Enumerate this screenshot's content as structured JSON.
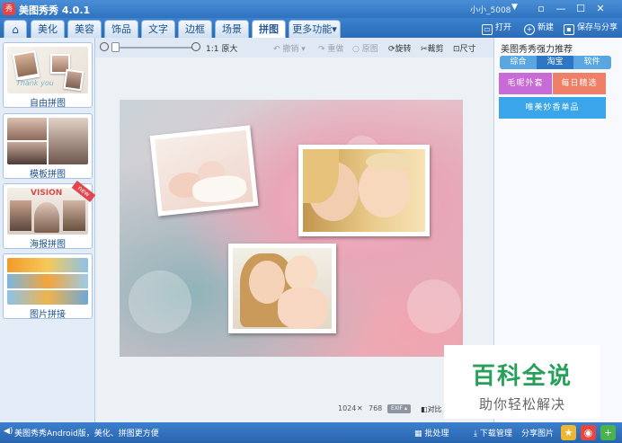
{
  "window": {
    "app_title": "美图秀秀 4.0.1",
    "logo_text": "秀",
    "user": "小小_5008",
    "controls": [
      "▫",
      "—",
      "☐",
      "✕"
    ]
  },
  "tabs": {
    "home_icon": "home-icon",
    "items": [
      "美化",
      "美容",
      "饰品",
      "文字",
      "边框",
      "场景",
      "拼图",
      "更多功能"
    ],
    "active": "拼图",
    "open_label": "打开",
    "new_label": "新建",
    "save_label": "保存与分享"
  },
  "left_panel": {
    "items": [
      {
        "label": "自由拼图",
        "thumb_text": "Thank you"
      },
      {
        "label": "模板拼图"
      },
      {
        "label": "海报拼图",
        "thumb_text": "VISION",
        "badge": "new"
      },
      {
        "label": "图片拼接"
      }
    ]
  },
  "toolbar": {
    "zoom_level": 10,
    "original_size_label": "1:1 原大",
    "undo_label": "撤销",
    "redo_label": "重做",
    "original_label": "原图",
    "rotate_label": "旋转",
    "crop_label": "裁剪",
    "size_label": "尺寸"
  },
  "canvas": {
    "width_value": "1024",
    "times": "✕",
    "height_value": "768",
    "exif_label": "EXIF ▴",
    "compare_label": "对比"
  },
  "right_panel": {
    "title": "美图秀秀强力推荐",
    "tabs": [
      "综合",
      "淘宝",
      "软件"
    ],
    "active_tab": "淘宝",
    "promos": [
      {
        "text": "毛呢外套",
        "color": "#c96bd6"
      },
      {
        "text": "每日精选",
        "color": "#f07f68"
      },
      {
        "text": "唯美妙香单品",
        "color": "#3aa5e8"
      }
    ]
  },
  "statusbar": {
    "speaker_icon": "speaker-icon",
    "message": "美图秀秀Android版，美化、拼图更方便",
    "batch_label": "批处理",
    "download_label": "下载管理",
    "share_label": "分享图片"
  },
  "watermark": {
    "title": "百科全说",
    "subtitle": "助你轻松解决"
  },
  "colors": {
    "accent": "#2f73c0",
    "tab_active": "#ffffff",
    "watermark_green": "#27a15a"
  }
}
